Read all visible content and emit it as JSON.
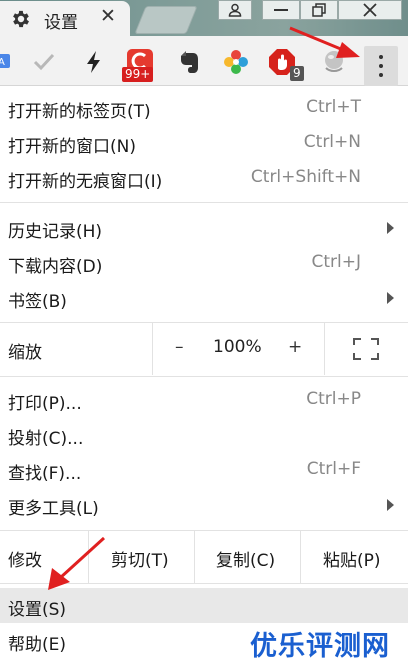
{
  "tab": {
    "title": "设置",
    "close": "✕",
    "icon": "gear-icon"
  },
  "window_controls": [
    "user-icon",
    "minimize-icon",
    "restore-icon",
    "close-icon"
  ],
  "toolbar": {
    "extensions": [
      {
        "name": "translate-icon",
        "badge": ""
      },
      {
        "name": "checkmark-icon",
        "badge": ""
      },
      {
        "name": "lightning-icon",
        "badge": ""
      },
      {
        "name": "extension-red-c-icon",
        "badge": "99+"
      },
      {
        "name": "evernote-icon",
        "badge": ""
      },
      {
        "name": "colorful-flower-icon",
        "badge": ""
      },
      {
        "name": "adblock-icon",
        "badge": "9"
      },
      {
        "name": "ghost-icon",
        "badge": ""
      }
    ],
    "menu_icon": "more-vert-icon"
  },
  "menu": {
    "new_tab": {
      "label": "打开新的标签页(T)",
      "accel": "Ctrl+T"
    },
    "new_window": {
      "label": "打开新的窗口(N)",
      "accel": "Ctrl+N"
    },
    "new_incognito": {
      "label": "打开新的无痕窗口(I)",
      "accel": "Ctrl+Shift+N"
    },
    "history": {
      "label": "历史记录(H)"
    },
    "downloads": {
      "label": "下载内容(D)",
      "accel": "Ctrl+J"
    },
    "bookmarks": {
      "label": "书签(B)"
    },
    "zoom": {
      "label": "缩放",
      "minus": "–",
      "value": "100%",
      "plus": "+"
    },
    "print": {
      "label": "打印(P)...",
      "accel": "Ctrl+P"
    },
    "cast": {
      "label": "投射(C)..."
    },
    "find": {
      "label": "查找(F)...",
      "accel": "Ctrl+F"
    },
    "more_tools": {
      "label": "更多工具(L)"
    },
    "edit": {
      "label": "修改",
      "cut": "剪切(T)",
      "copy": "复制(C)",
      "paste": "粘贴(P)"
    },
    "settings": {
      "label": "设置(S)"
    },
    "help": {
      "label": "帮助(E)"
    }
  },
  "watermark": "优乐评测网",
  "colors": {
    "annotation_arrow": "#e02020",
    "watermark": "#1a5fd0",
    "highlight": "#e8e8e8"
  }
}
